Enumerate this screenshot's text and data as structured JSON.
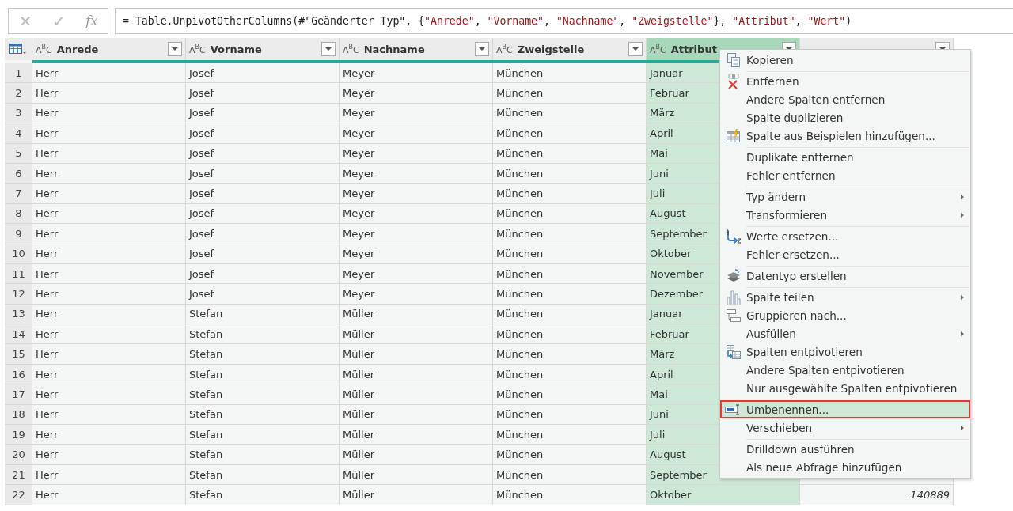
{
  "formula_bar": {
    "cancel": "✕",
    "confirm": "✓",
    "fx": "fx",
    "formula": [
      {
        "kind": "code",
        "text": "= Table.UnpivotOtherColumns(#\"Geänderter Typ\", {"
      },
      {
        "kind": "string",
        "text": "\"Anrede\""
      },
      {
        "kind": "code",
        "text": ", "
      },
      {
        "kind": "string",
        "text": "\"Vorname\""
      },
      {
        "kind": "code",
        "text": ", "
      },
      {
        "kind": "string",
        "text": "\"Nachname\""
      },
      {
        "kind": "code",
        "text": ", "
      },
      {
        "kind": "string",
        "text": "\"Zweigstelle\""
      },
      {
        "kind": "code",
        "text": "}, "
      },
      {
        "kind": "string",
        "text": "\"Attribut\""
      },
      {
        "kind": "code",
        "text": ", "
      },
      {
        "kind": "string",
        "text": "\"Wert\""
      },
      {
        "kind": "code",
        "text": ")"
      }
    ]
  },
  "table": {
    "columns": [
      {
        "type_label": "A$^{B}$C",
        "name": "Anrede",
        "selected": false
      },
      {
        "type_label": "A$^{B}$C",
        "name": "Vorname",
        "selected": false
      },
      {
        "type_label": "A$^{B}$C",
        "name": "Nachname",
        "selected": false
      },
      {
        "type_label": "A$^{B}$C",
        "name": "Zweigstelle",
        "selected": false
      },
      {
        "type_label": "A$^{B}$C",
        "name": "Attribut",
        "selected": true
      },
      {
        "selected": false
      }
    ],
    "rows": [
      {
        "index": "1",
        "cells": [
          "Herr",
          "Josef",
          "Meyer",
          "München",
          "Januar"
        ]
      },
      {
        "index": "2",
        "cells": [
          "Herr",
          "Josef",
          "Meyer",
          "München",
          "Februar"
        ]
      },
      {
        "index": "3",
        "cells": [
          "Herr",
          "Josef",
          "Meyer",
          "München",
          "März"
        ]
      },
      {
        "index": "4",
        "cells": [
          "Herr",
          "Josef",
          "Meyer",
          "München",
          "April"
        ]
      },
      {
        "index": "5",
        "cells": [
          "Herr",
          "Josef",
          "Meyer",
          "München",
          "Mai"
        ]
      },
      {
        "index": "6",
        "cells": [
          "Herr",
          "Josef",
          "Meyer",
          "München",
          "Juni"
        ]
      },
      {
        "index": "7",
        "cells": [
          "Herr",
          "Josef",
          "Meyer",
          "München",
          "Juli"
        ]
      },
      {
        "index": "8",
        "cells": [
          "Herr",
          "Josef",
          "Meyer",
          "München",
          "August"
        ]
      },
      {
        "index": "9",
        "cells": [
          "Herr",
          "Josef",
          "Meyer",
          "München",
          "September"
        ]
      },
      {
        "index": "10",
        "cells": [
          "Herr",
          "Josef",
          "Meyer",
          "München",
          "Oktober"
        ]
      },
      {
        "index": "11",
        "cells": [
          "Herr",
          "Josef",
          "Meyer",
          "München",
          "November"
        ]
      },
      {
        "index": "12",
        "cells": [
          "Herr",
          "Josef",
          "Meyer",
          "München",
          "Dezember"
        ]
      },
      {
        "index": "13",
        "cells": [
          "Herr",
          "Stefan",
          "Müller",
          "München",
          "Januar"
        ]
      },
      {
        "index": "14",
        "cells": [
          "Herr",
          "Stefan",
          "Müller",
          "München",
          "Februar"
        ]
      },
      {
        "index": "15",
        "cells": [
          "Herr",
          "Stefan",
          "Müller",
          "München",
          "März"
        ]
      },
      {
        "index": "16",
        "cells": [
          "Herr",
          "Stefan",
          "Müller",
          "München",
          "April"
        ]
      },
      {
        "index": "17",
        "cells": [
          "Herr",
          "Stefan",
          "Müller",
          "München",
          "Mai"
        ]
      },
      {
        "index": "18",
        "cells": [
          "Herr",
          "Stefan",
          "Müller",
          "München",
          "Juni"
        ]
      },
      {
        "index": "19",
        "cells": [
          "Herr",
          "Stefan",
          "Müller",
          "München",
          "Juli"
        ]
      },
      {
        "index": "20",
        "cells": [
          "Herr",
          "Stefan",
          "Müller",
          "München",
          "August"
        ]
      },
      {
        "index": "21",
        "cells": [
          "Herr",
          "Stefan",
          "Müller",
          "München",
          "September"
        ]
      },
      {
        "index": "22",
        "cells": [
          "Herr",
          "Stefan",
          "Müller",
          "München",
          "Oktober",
          "140889"
        ]
      }
    ]
  },
  "context_menu": {
    "items": [
      {
        "label": "Kopieren",
        "separator_before": false,
        "has_submenu": false,
        "selected": false
      },
      {
        "label": "Entfernen",
        "separator_before": true,
        "has_submenu": false,
        "selected": false
      },
      {
        "label": "Andere Spalten entfernen",
        "separator_before": false,
        "has_submenu": false,
        "selected": false
      },
      {
        "label": "Spalte duplizieren",
        "separator_before": false,
        "has_submenu": false,
        "selected": false
      },
      {
        "label": "Spalte aus Beispielen hinzufügen...",
        "separator_before": false,
        "has_submenu": false,
        "selected": false
      },
      {
        "label": "Duplikate entfernen",
        "separator_before": true,
        "has_submenu": false,
        "selected": false
      },
      {
        "label": "Fehler entfernen",
        "separator_before": false,
        "has_submenu": false,
        "selected": false
      },
      {
        "label": "Typ ändern",
        "separator_before": true,
        "has_submenu": true,
        "selected": false
      },
      {
        "label": "Transformieren",
        "separator_before": false,
        "has_submenu": true,
        "selected": false
      },
      {
        "label": "Werte ersetzen...",
        "separator_before": true,
        "has_submenu": false,
        "selected": false
      },
      {
        "label": "Fehler ersetzen...",
        "separator_before": false,
        "has_submenu": false,
        "selected": false
      },
      {
        "label": "Datentyp erstellen",
        "separator_before": true,
        "has_submenu": false,
        "selected": false
      },
      {
        "label": "Spalte teilen",
        "separator_before": true,
        "has_submenu": true,
        "selected": false
      },
      {
        "label": "Gruppieren nach...",
        "separator_before": false,
        "has_submenu": false,
        "selected": false
      },
      {
        "label": "Ausfüllen",
        "separator_before": false,
        "has_submenu": true,
        "selected": false
      },
      {
        "label": "Spalten entpivotieren",
        "separator_before": false,
        "has_submenu": false,
        "selected": false
      },
      {
        "label": "Andere Spalten entpivotieren",
        "separator_before": false,
        "has_submenu": false,
        "selected": false
      },
      {
        "label": "Nur ausgewählte Spalten entpivotieren",
        "separator_before": false,
        "has_submenu": false,
        "selected": false
      },
      {
        "label": "Umbenennen...",
        "separator_before": true,
        "has_submenu": false,
        "selected": true
      },
      {
        "label": "Verschieben",
        "separator_before": false,
        "has_submenu": true,
        "selected": false
      },
      {
        "label": "Drilldown ausführen",
        "separator_before": true,
        "has_submenu": false,
        "selected": false
      },
      {
        "label": "Als neue Abfrage hinzufügen",
        "separator_before": false,
        "has_submenu": false,
        "selected": false
      }
    ]
  }
}
